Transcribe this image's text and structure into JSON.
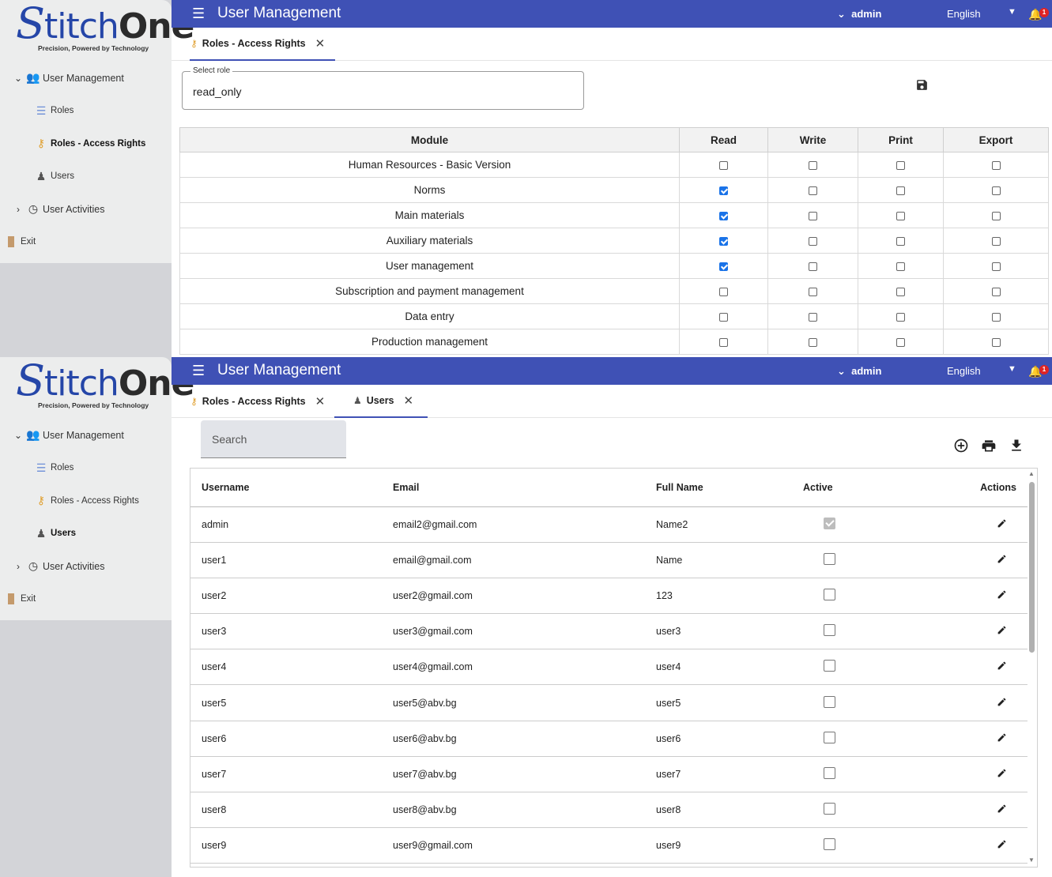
{
  "app": {
    "logo_s": "S",
    "logo_stitch": "titch",
    "logo_one": "One",
    "logo_tagline": "Precision, Powered by Technology"
  },
  "header": {
    "title": "User Management",
    "user": "admin",
    "language": "English",
    "notification_count": "1",
    "color": "#3f51b5"
  },
  "sidebar": {
    "group": "User Management",
    "items": [
      "Roles",
      "Roles - Access Rights",
      "Users"
    ],
    "activities": "User Activities",
    "exit": "Exit"
  },
  "pane1": {
    "tab": "Roles - Access Rights",
    "select_label": "Select role",
    "select_value": "read_only",
    "columns": [
      "Module",
      "Read",
      "Write",
      "Print",
      "Export"
    ],
    "rows": [
      {
        "module": "Human Resources - Basic Version",
        "read": false,
        "write": false,
        "print": false,
        "export": false
      },
      {
        "module": "Norms",
        "read": true,
        "write": false,
        "print": false,
        "export": false
      },
      {
        "module": "Main materials",
        "read": true,
        "write": false,
        "print": false,
        "export": false
      },
      {
        "module": "Auxiliary materials",
        "read": true,
        "write": false,
        "print": false,
        "export": false
      },
      {
        "module": "User management",
        "read": true,
        "write": false,
        "print": false,
        "export": false
      },
      {
        "module": "Subscription and payment management",
        "read": false,
        "write": false,
        "print": false,
        "export": false
      },
      {
        "module": "Data entry",
        "read": false,
        "write": false,
        "print": false,
        "export": false
      },
      {
        "module": "Production management",
        "read": false,
        "write": false,
        "print": false,
        "export": false
      }
    ]
  },
  "pane2": {
    "tabs": [
      "Roles - Access Rights",
      "Users"
    ],
    "search_placeholder": "Search",
    "columns": [
      "Username",
      "Email",
      "Full Name",
      "Active",
      "Actions"
    ],
    "rows": [
      {
        "username": "admin",
        "email": "email2@gmail.com",
        "full_name": "Name2",
        "active": true
      },
      {
        "username": "user1",
        "email": "email@gmail.com",
        "full_name": "Name",
        "active": false
      },
      {
        "username": "user2",
        "email": "user2@gmail.com",
        "full_name": "123",
        "active": false
      },
      {
        "username": "user3",
        "email": "user3@gmail.com",
        "full_name": "user3",
        "active": false
      },
      {
        "username": "user4",
        "email": "user4@gmail.com",
        "full_name": "user4",
        "active": false
      },
      {
        "username": "user5",
        "email": "user5@abv.bg",
        "full_name": "user5",
        "active": false
      },
      {
        "username": "user6",
        "email": "user6@abv.bg",
        "full_name": "user6",
        "active": false
      },
      {
        "username": "user7",
        "email": "user7@abv.bg",
        "full_name": "user7",
        "active": false
      },
      {
        "username": "user8",
        "email": "user8@abv.bg",
        "full_name": "user8",
        "active": false
      },
      {
        "username": "user9",
        "email": "user9@gmail.com",
        "full_name": "user9",
        "active": false
      }
    ]
  }
}
